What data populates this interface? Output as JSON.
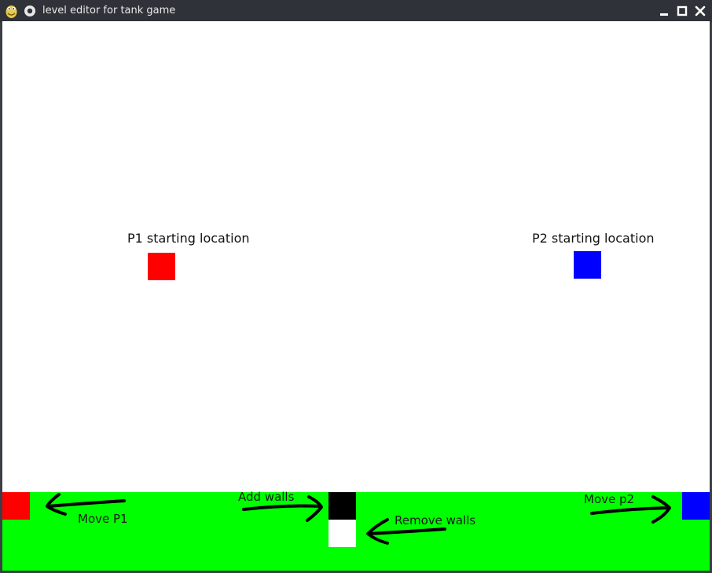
{
  "window": {
    "title": "level editor for tank game",
    "icons": {
      "app": "pygame-snake-icon",
      "menu": "window-menu-icon",
      "minimize": "minimize-icon",
      "maximize": "maximize-icon",
      "close": "close-icon"
    }
  },
  "canvas": {
    "p1_label": "P1 starting location",
    "p2_label": "P2 starting location",
    "colors": {
      "background": "#ffffff",
      "toolbar": "#00ff00",
      "p1": "#ff0000",
      "p2": "#0000ff",
      "wall": "#000000",
      "empty": "#ffffff"
    }
  },
  "toolbar": {
    "move_p1": "Move P1",
    "add_walls": "Add walls",
    "remove_walls": "Remove walls",
    "move_p2": "Move p2"
  }
}
